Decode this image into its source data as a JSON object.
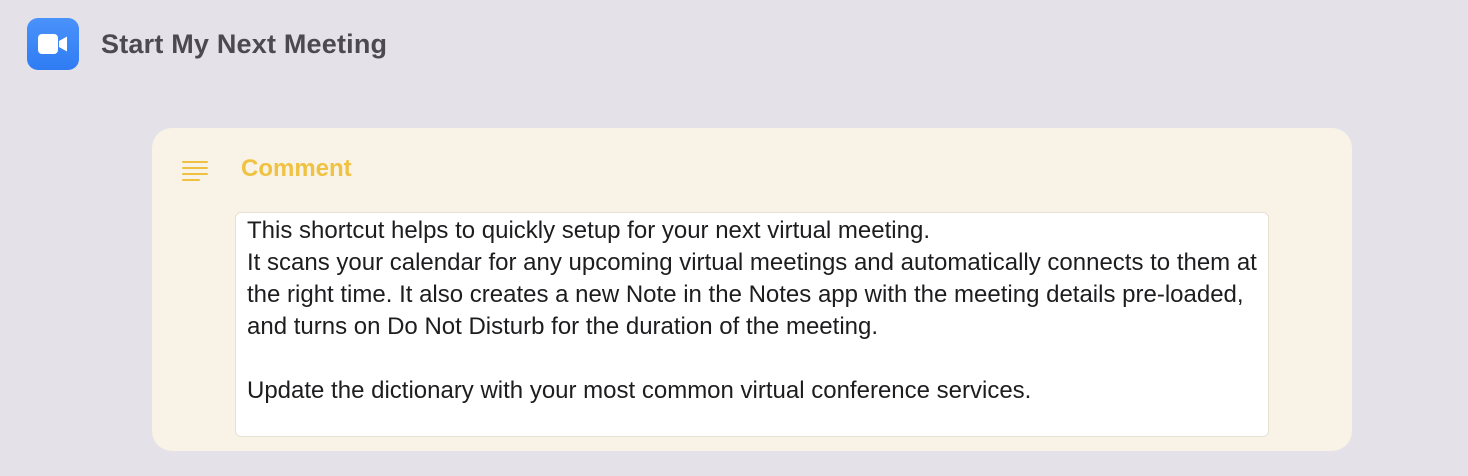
{
  "shortcut": {
    "title": "Start My Next Meeting",
    "icon": "video-camera-icon",
    "icon_color": "#3b86f7"
  },
  "comment_action": {
    "label": "Comment",
    "icon": "text-lines-icon",
    "accent_color": "#f0c243",
    "text": "This shortcut helps to quickly setup for your next virtual meeting.\nIt scans your calendar for any upcoming virtual meetings and automatically connects to them at the right time. It also creates a new Note in the Notes app with the meeting details pre-loaded, and turns on Do Not Disturb for the duration of the meeting.\n\nUpdate the dictionary with your most common virtual conference services."
  }
}
